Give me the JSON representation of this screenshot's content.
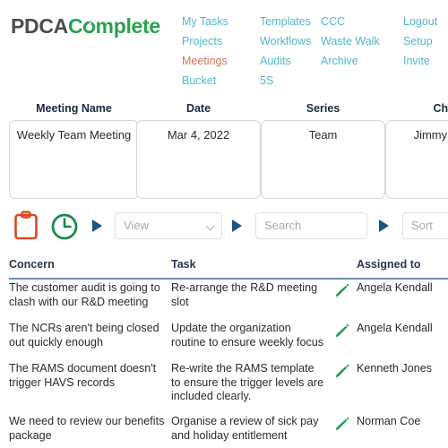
{
  "brand": {
    "logo_part1": "PDCA",
    "logo_part2_pre": "C",
    "logo_part2_o": "o",
    "logo_part2_post": "mplete",
    "color_dark": "#4d4d4d",
    "color_green": "#2aa14f"
  },
  "nav": {
    "active_color": "#d3735c",
    "link_color": "#56b6c8",
    "items": [
      {
        "label": "My Tasks",
        "active": false
      },
      {
        "label": "Templates",
        "active": false
      },
      {
        "label": "CCC",
        "active": false
      },
      {
        "label": "Logout",
        "active": false
      },
      {
        "label": "Projects",
        "active": false
      },
      {
        "label": "Workflows",
        "active": false
      },
      {
        "label": "Waste Walk",
        "active": false
      },
      {
        "label": "Setup",
        "active": false
      },
      {
        "label": "Meetings",
        "active": true
      },
      {
        "label": "Audits",
        "active": false
      },
      {
        "label": "Archive",
        "active": false
      },
      {
        "label": "Invite",
        "active": false
      },
      {
        "label": "Bucket",
        "active": false
      },
      {
        "label": "5S",
        "active": false
      },
      {
        "label": "",
        "active": false
      },
      {
        "label": "",
        "active": false
      }
    ]
  },
  "meeting_cards": [
    {
      "header": "Meeting Name",
      "value": "Weekly Team Meeting"
    },
    {
      "header": "Date",
      "value": "Mar 4, 2022"
    },
    {
      "header": "Series",
      "value": "Team"
    },
    {
      "header": "Chair",
      "value": "Jimmy Jones"
    }
  ],
  "toolbar": {
    "clipboard_icon": "clipboard-icon",
    "clock_icon": "clock-icon",
    "arrow_icon": "play-triangle-icon",
    "view_label": "View",
    "search_placeholder": "Search",
    "sort_label": "Sort",
    "triangle_color": "#1b5480",
    "clipboard_color": "#d44a22",
    "clock_color": "#188a4a"
  },
  "table": {
    "columns": [
      "Concern",
      "Task",
      "Assigned to"
    ],
    "rule_color": "#6b8fae",
    "rows": [
      {
        "concern": "The customer audit is going to clash with our R&D meeting",
        "task": "Re-arrange the R&D meeting slot",
        "assignee": "Angela Kendall",
        "edit_icon": "pencil-icon"
      },
      {
        "concern": "The NCRs aren't being closed out quickly enough",
        "task": "Update the organization routine to ensure weekly focus",
        "assignee": "Angela Kendall",
        "edit_icon": "pencil-icon"
      },
      {
        "concern": "The RAMS document doesn't trigger HAVS records",
        "task": "Re-write the RAMS template to ensure the trigger levels are included clearly.",
        "assignee": "Kenneth Jones",
        "edit_icon": "pencil-icon"
      },
      {
        "concern": "We need to review our benefits package",
        "task": "Organise a review of sick pay and holiday entitlement",
        "assignee": "Norman Coe",
        "edit_icon": "pencil-icon"
      }
    ]
  }
}
